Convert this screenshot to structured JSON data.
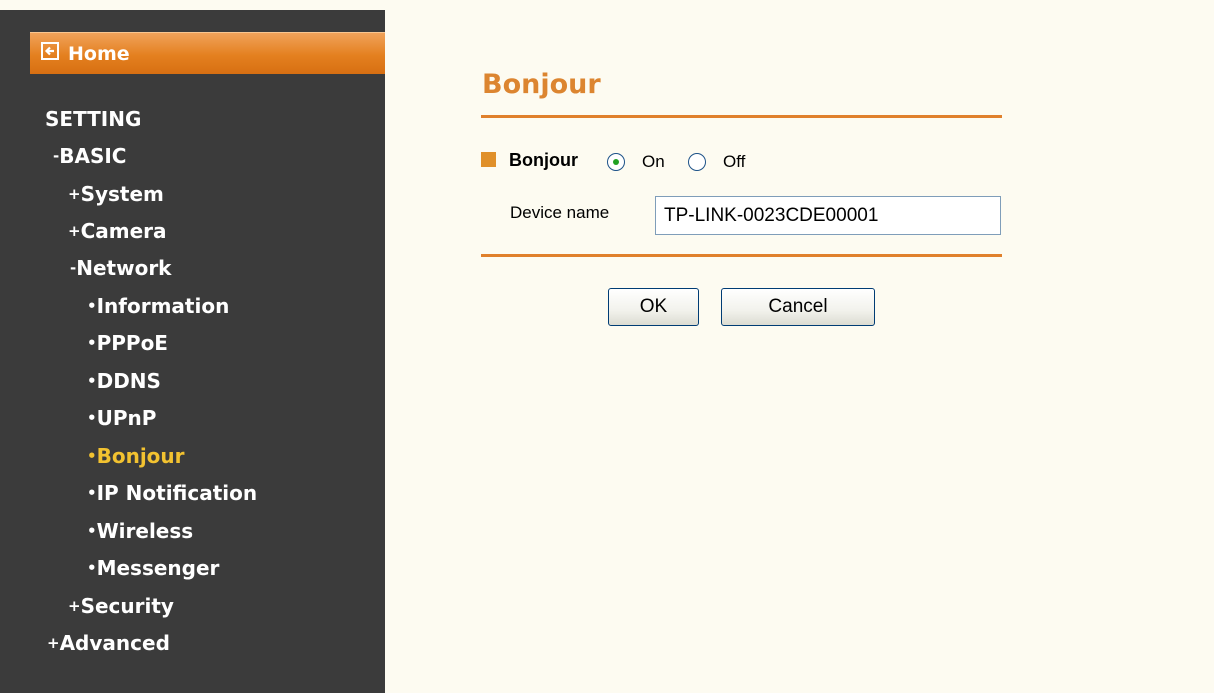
{
  "sidebar": {
    "home_label": "Home",
    "setting": "SETTING",
    "basic": "BASIC",
    "system": "System",
    "camera": "Camera",
    "network": "Network",
    "network_items": [
      "Information",
      "PPPoE",
      "DDNS",
      "UPnP",
      "Bonjour",
      "IP Notification",
      "Wireless",
      "Messenger"
    ],
    "security": "Security",
    "advanced": "Advanced",
    "active_item": "Bonjour",
    "colors": {
      "background": "#3b3b3b",
      "home_bar": "#e4801f",
      "active_text": "#f2c230"
    }
  },
  "main": {
    "title": "Bonjour",
    "bonjour_label": "Bonjour",
    "radio_on": "On",
    "radio_off": "Off",
    "selected": "On",
    "device_name_label": "Device name",
    "device_name_value": "TP-LINK-0023CDE00001",
    "ok_label": "OK",
    "cancel_label": "Cancel",
    "colors": {
      "title": "#dc8530",
      "rule": "#e0802c",
      "background": "#fdfbf1"
    }
  }
}
